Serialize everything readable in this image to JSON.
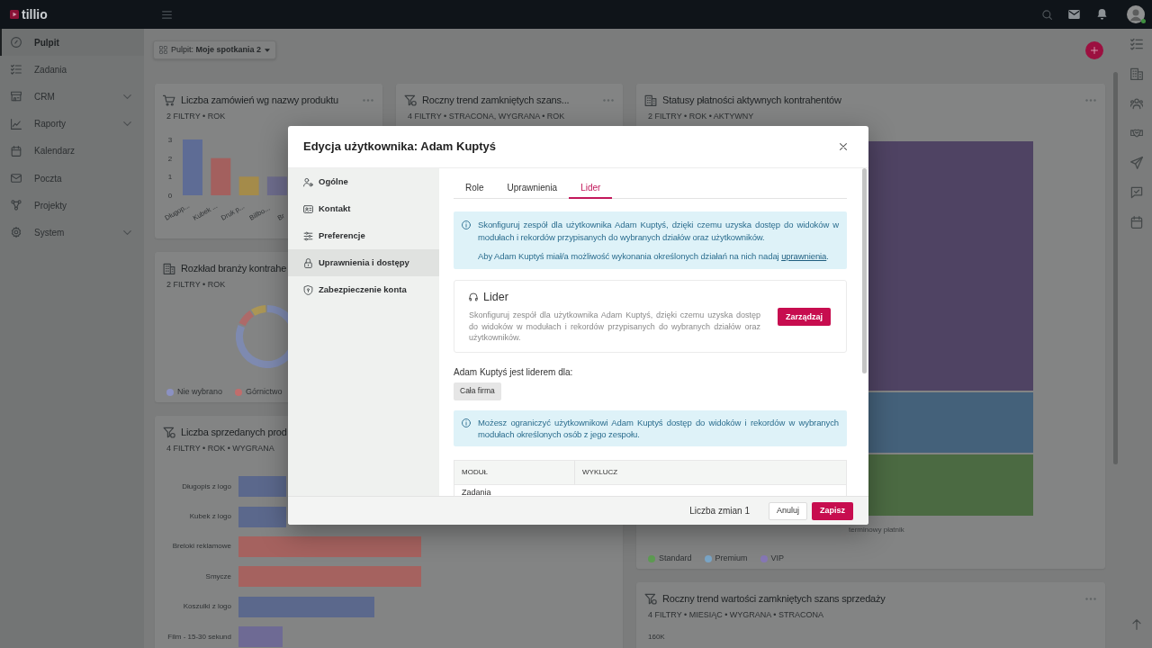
{
  "topbar": {
    "logo": "tillio"
  },
  "sidebar": {
    "items": [
      {
        "label": "Pulpit",
        "kind": "link",
        "selected": true
      },
      {
        "label": "Zadania",
        "kind": "link",
        "selected": false
      },
      {
        "label": "CRM",
        "kind": "group",
        "selected": false
      },
      {
        "label": "Raporty",
        "kind": "group",
        "selected": false
      },
      {
        "label": "Kalendarz",
        "kind": "link",
        "selected": false
      },
      {
        "label": "Poczta",
        "kind": "link",
        "selected": false
      },
      {
        "label": "Projekty",
        "kind": "link",
        "selected": false
      },
      {
        "label": "System",
        "kind": "group",
        "selected": false
      }
    ]
  },
  "dashboard": {
    "selector": "Pulpit: **Moje spotkania 2**",
    "cards": [
      {
        "kind": "column_chart",
        "title": "Liczba zamówień wg nazwy produktu",
        "filters": "2 FILTRY • ROK",
        "more_menu": true,
        "chart_data": {
          "type": "bar",
          "categories": [
            "Długop...",
            "Kubek ...",
            "Druk p...",
            "Billbo...",
            "Br"
          ],
          "series": [
            {
              "values": [
                3,
                2,
                1,
                1,
                null
              ]
            }
          ],
          "ylim": [
            0,
            3
          ],
          "yticks": [
            0,
            1,
            2,
            3
          ]
        }
      },
      {
        "kind": "covered",
        "title": "Roczny trend zamkniętych szans...",
        "filters": "4 FILTRY • STRACONA, WYGRANA • ROK",
        "more_menu": true
      },
      {
        "kind": "donut",
        "title": "Rozkład branży kontrahe",
        "filters": "2 FILTRY • ROK",
        "more_menu": false,
        "legend": [
          {
            "label": "Nie wybrano",
            "color": "#8b91c2"
          },
          {
            "label": "Górnictwo",
            "color": "#c06d6c"
          }
        ]
      },
      {
        "kind": "bar_list",
        "title": "Liczba sprzedanych prod",
        "filters": "4 FILTRY • ROK • WYGRANA",
        "more_menu": false,
        "bars": [
          {
            "label": "Długopis z logo",
            "color": "#5b688c"
          },
          {
            "label": "Kubek z logo",
            "color": "#5b688c"
          },
          {
            "label": "Breloki reklamowe",
            "color": "#a5625f"
          },
          {
            "label": "Smycze",
            "color": "#a5625f"
          },
          {
            "label": "Koszulki z logo",
            "color": "#5b688c"
          },
          {
            "label": "Film - 15-30 sekund",
            "color": "#6e6a94"
          }
        ]
      },
      {
        "kind": "stacked",
        "title": "Statusy płatności aktywnych kontrahentów",
        "filters": "2 FILTRY • ROK • AKTYWNY",
        "more_menu": true,
        "category": "terminowy płatnik",
        "legend": [
          {
            "label": "Standard",
            "color": "#5d9b52"
          },
          {
            "label": "Premium",
            "color": "#79a5c6"
          },
          {
            "label": "VIP",
            "color": "#8677b5"
          }
        ]
      },
      {
        "kind": "line",
        "title": "Roczny trend wartości zamkniętych szans sprzedaży",
        "filters": "4 FILTRY • MIESIĄC • WYGRANA • STRACONA",
        "more_menu": true,
        "axis_label": "160K"
      }
    ]
  },
  "modal": {
    "title": "Edycja użytkownika: Adam Kuptyś",
    "nav": [
      {
        "label": "Ogólne",
        "selected": false
      },
      {
        "label": "Kontakt",
        "selected": false
      },
      {
        "label": "Preferencje",
        "selected": false
      },
      {
        "label": "Uprawnienia i dostępy",
        "selected": true
      },
      {
        "label": "Zabezpieczenie konta",
        "selected": false
      }
    ],
    "tabs": [
      {
        "label": "Role",
        "selected": false
      },
      {
        "label": "Uprawnienia",
        "selected": false
      },
      {
        "label": "Lider",
        "selected": true
      }
    ],
    "notice": {
      "text": "Skonfiguruj zespół dla użytkownika Adam Kuptyś, dzięki czemu uzyska dostęp do widoków w modułach i rekordów przypisanych do wybranych działów oraz użytkowników.",
      "hint": "Aby Adam Kuptyś miał/a możliwość wykonania określonych działań na nich nadaj ",
      "link": "uprawnienia",
      "hint_end": "."
    },
    "leader_card": {
      "title": "Lider",
      "description": "Skonfiguruj zespół dla użytkownika Adam Kuptyś, dzięki czemu uzyska dostęp do widoków w modułach i rekordów przypisanych do wybranych działów oraz użytkowników.",
      "button": "Zarządzaj"
    },
    "leader_of": {
      "label": "Adam Kuptyś jest liderem dla:",
      "chips": [
        "Cała firma"
      ]
    },
    "restriction_notice": {
      "text": "Możesz ograniczyć użytkownikowi Adam Kuptyś dostęp do widoków i rekordów w wybranych modułach określonych osób z jego zespołu."
    },
    "table": {
      "columns": [
        "MODUŁ",
        "WYKLUCZ"
      ],
      "rows": [
        [
          "Zadania"
        ]
      ]
    },
    "footer": {
      "changes": "Liczba zmian 1",
      "buttons": [
        {
          "label": "Anuluj",
          "kind": "secondary"
        },
        {
          "label": "Zapisz",
          "kind": "primary"
        }
      ]
    }
  }
}
